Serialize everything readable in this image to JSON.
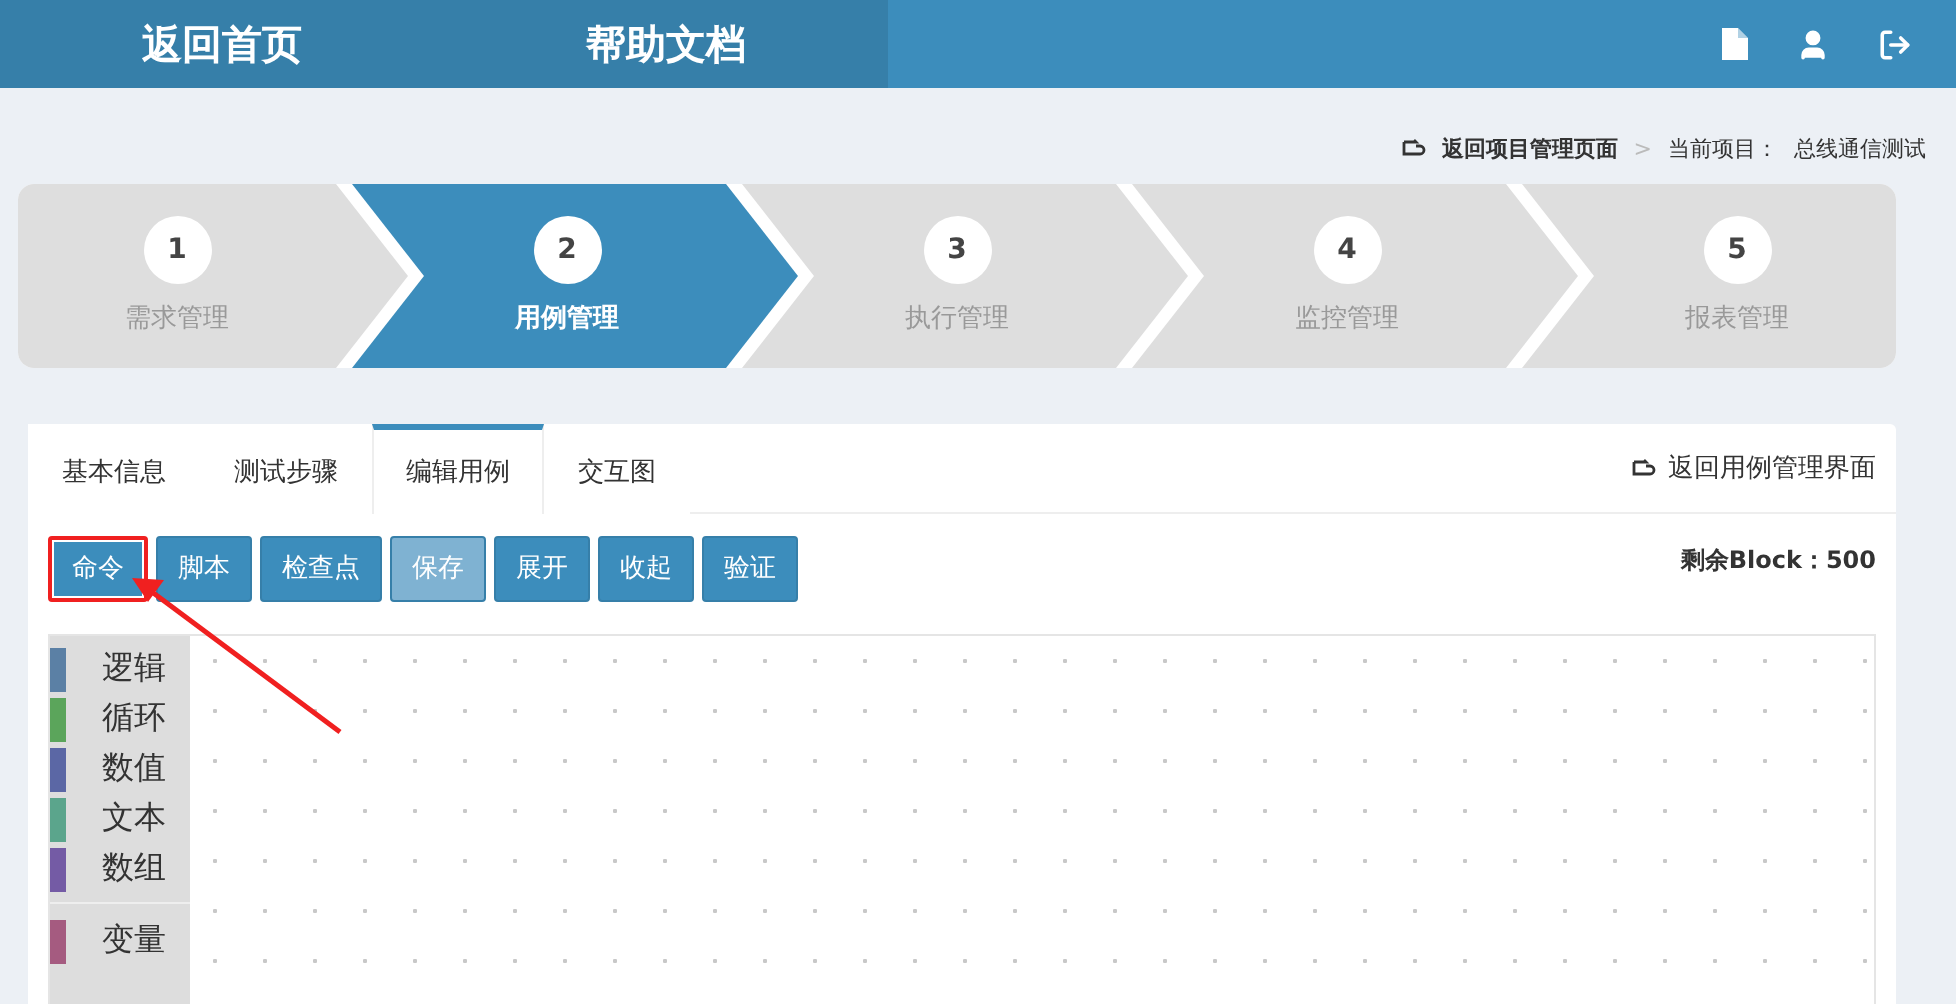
{
  "header": {
    "nav": [
      {
        "label": "返回首页",
        "selected": false
      },
      {
        "label": "帮助文档",
        "selected": false
      }
    ]
  },
  "breadcrumb": {
    "back_link": "返回项目管理页面",
    "separator": ">",
    "current_label": "当前项目：",
    "current_project": "总线通信测试"
  },
  "steps": [
    {
      "number": "1",
      "label": "需求管理",
      "selected": false
    },
    {
      "number": "2",
      "label": "用例管理",
      "selected": true
    },
    {
      "number": "3",
      "label": "执行管理",
      "selected": false
    },
    {
      "number": "4",
      "label": "监控管理",
      "selected": false
    },
    {
      "number": "5",
      "label": "报表管理",
      "selected": false
    }
  ],
  "tabs": [
    {
      "label": "基本信息",
      "selected": false
    },
    {
      "label": "测试步骤",
      "selected": false
    },
    {
      "label": "编辑用例",
      "selected": true
    },
    {
      "label": "交互图",
      "selected": false
    }
  ],
  "back_to_cases": "返回用例管理界面",
  "toolbar": [
    {
      "label": "命令",
      "disabled": false,
      "highlighted": true
    },
    {
      "label": "脚本",
      "disabled": false,
      "highlighted": false
    },
    {
      "label": "检查点",
      "disabled": false,
      "highlighted": false
    },
    {
      "label": "保存",
      "disabled": true,
      "highlighted": false
    },
    {
      "label": "展开",
      "disabled": false,
      "highlighted": false
    },
    {
      "label": "收起",
      "disabled": false,
      "highlighted": false
    },
    {
      "label": "验证",
      "disabled": false,
      "highlighted": false
    }
  ],
  "remaining": "剩余Block：500",
  "categories": [
    {
      "label": "逻辑",
      "color": "#5b80a5"
    },
    {
      "label": "循环",
      "color": "#5ba55b"
    },
    {
      "label": "数值",
      "color": "#5b67a5"
    },
    {
      "label": "文本",
      "color": "#5ba58c"
    },
    {
      "label": "数组",
      "color": "#745ba5"
    }
  ],
  "variable_categories": [
    {
      "label": "变量",
      "color": "#a55b80"
    }
  ]
}
